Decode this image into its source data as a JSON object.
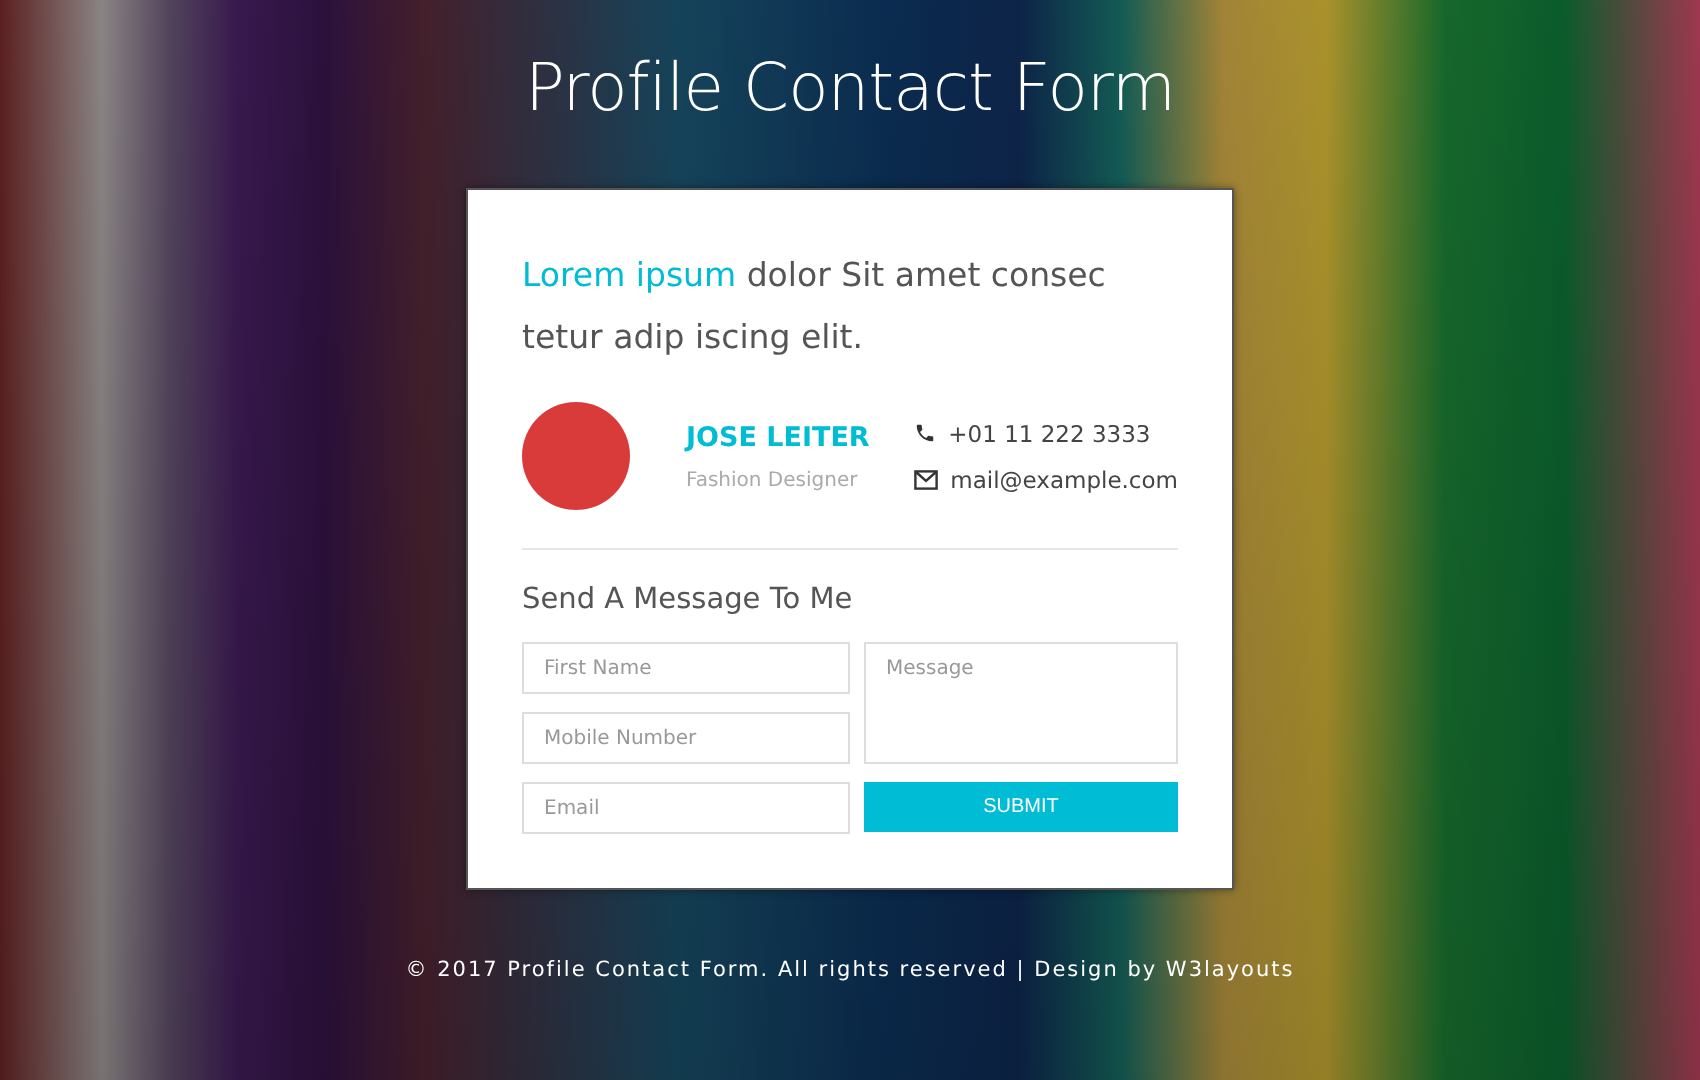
{
  "page_title": "Profile Contact Form",
  "card": {
    "intro": {
      "highlight": "Lorem ipsum",
      "rest": " dolor Sit amet consec tetur adip iscing elit."
    },
    "profile": {
      "name": "JOSE LEITER",
      "role": "Fashion Designer"
    },
    "contacts": [
      {
        "kind": "phone",
        "text": "+01 11 222 3333"
      },
      {
        "kind": "email",
        "text": "mail@example.com"
      }
    ],
    "form_title": "Send A Message To Me",
    "fields": [
      {
        "placeholder": "First Name"
      },
      {
        "placeholder": "Mobile Number"
      },
      {
        "placeholder": "Email"
      }
    ],
    "message": {
      "placeholder": "Message"
    },
    "submit": "SUBMIT"
  },
  "footer": "© 2017 Profile Contact Form. All rights reserved | Design by W3layouts"
}
